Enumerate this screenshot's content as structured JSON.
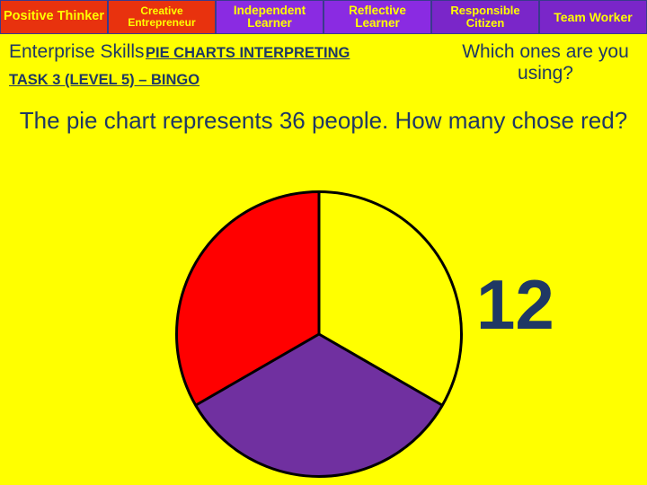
{
  "skills_bar": {
    "items": [
      {
        "label": "Positive Thinker"
      },
      {
        "label": "Creative Entrepreneur"
      },
      {
        "label": "Independent Learner"
      },
      {
        "label": "Reflective Learner"
      },
      {
        "label": "Responsible Citizen"
      },
      {
        "label": "Team Worker"
      }
    ]
  },
  "header": {
    "enterprise_skills": "Enterprise Skills",
    "pie_charts_title": "PIE CHARTS INTERPRETING",
    "which_ones": "Which ones are you using?",
    "task_line": "TASK 3 (LEVEL 5) – BINGO"
  },
  "question": "The pie chart represents 36 people. How many chose red?",
  "answer": "12",
  "chart_data": {
    "type": "pie",
    "title": "",
    "total_people": 36,
    "categories": [
      "Yellow",
      "Purple",
      "Red"
    ],
    "values": [
      12,
      12,
      12
    ],
    "percent": [
      33.3,
      33.3,
      33.3
    ],
    "colors": [
      "#FFFF00",
      "#7030A0",
      "#FF0000"
    ],
    "legend": "none",
    "border_color": "#000000"
  }
}
